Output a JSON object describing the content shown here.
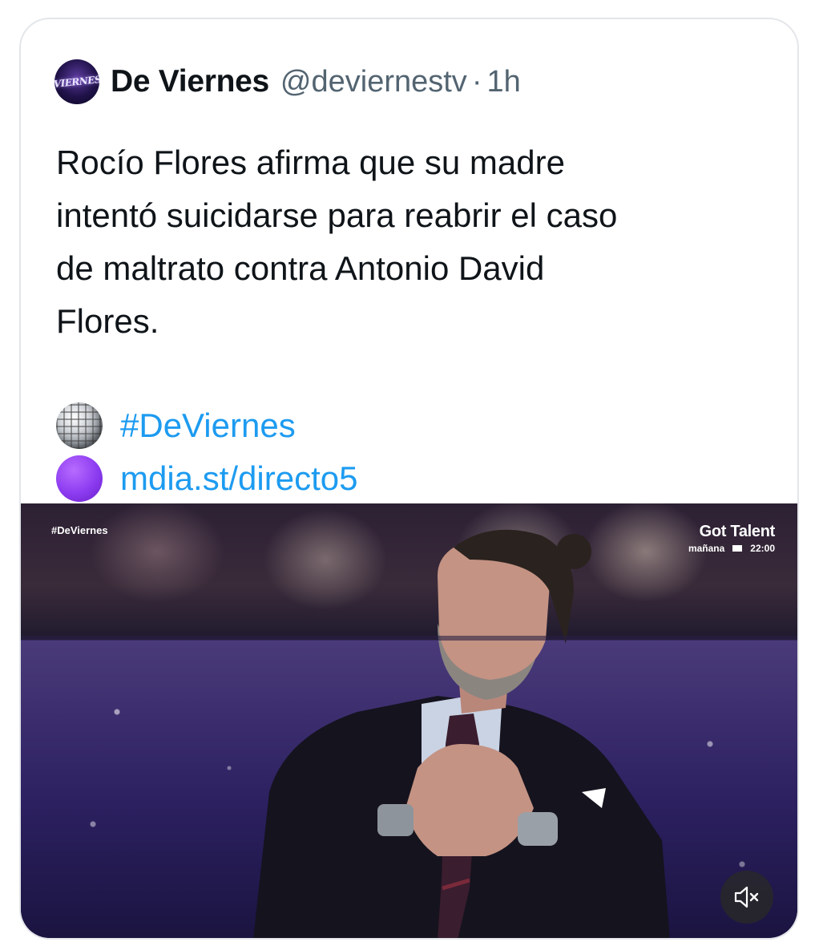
{
  "tweet": {
    "author_name": "De Viernes",
    "handle": "@deviernestv",
    "separator": "·",
    "time": "1h",
    "avatar_text": "¡VIERNES!",
    "text": "Rocío Flores afirma que su madre\nintentó suicidarse para reabrir el caso\nde maltrato contra Antonio David\nFlores.",
    "hashtag_emoji": "disco-ball-icon",
    "hashtag": "#DeViernes",
    "link_emoji": "purple-circle-icon",
    "link": "mdia.st/directo5",
    "link_color": "#1d9bf0"
  },
  "media": {
    "overlay_hashtag": "#DeViernes",
    "promo_title": "Got Talent",
    "promo_day": "mañana",
    "promo_time": "22:00",
    "mute_icon": "speaker-muted-icon"
  }
}
